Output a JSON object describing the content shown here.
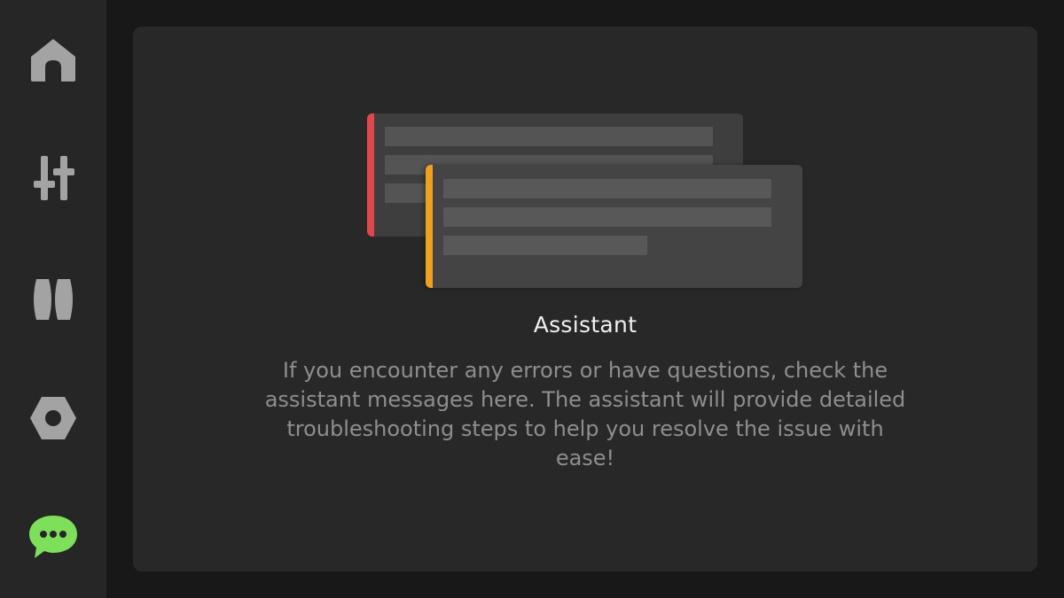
{
  "sidebar": {
    "items": [
      {
        "icon": "home-icon",
        "active": false
      },
      {
        "icon": "sliders-icon",
        "active": false
      },
      {
        "icon": "rollers-icon",
        "active": false
      },
      {
        "icon": "hex-nut-icon",
        "active": false
      },
      {
        "icon": "chat-bubble-icon",
        "active": true
      }
    ]
  },
  "main": {
    "title": "Assistant",
    "description": "If you encounter any errors or have questions, check the assistant messages here. The assistant will provide detailed troubleshooting steps to help you resolve the issue with ease!"
  },
  "colors": {
    "background": "#181818",
    "sidebar": "#262626",
    "panel": "#282828",
    "icon_inactive": "#a3a3a3",
    "icon_active": "#7ee05a",
    "error_accent": "#e0464a",
    "warning_accent": "#f0a020"
  }
}
